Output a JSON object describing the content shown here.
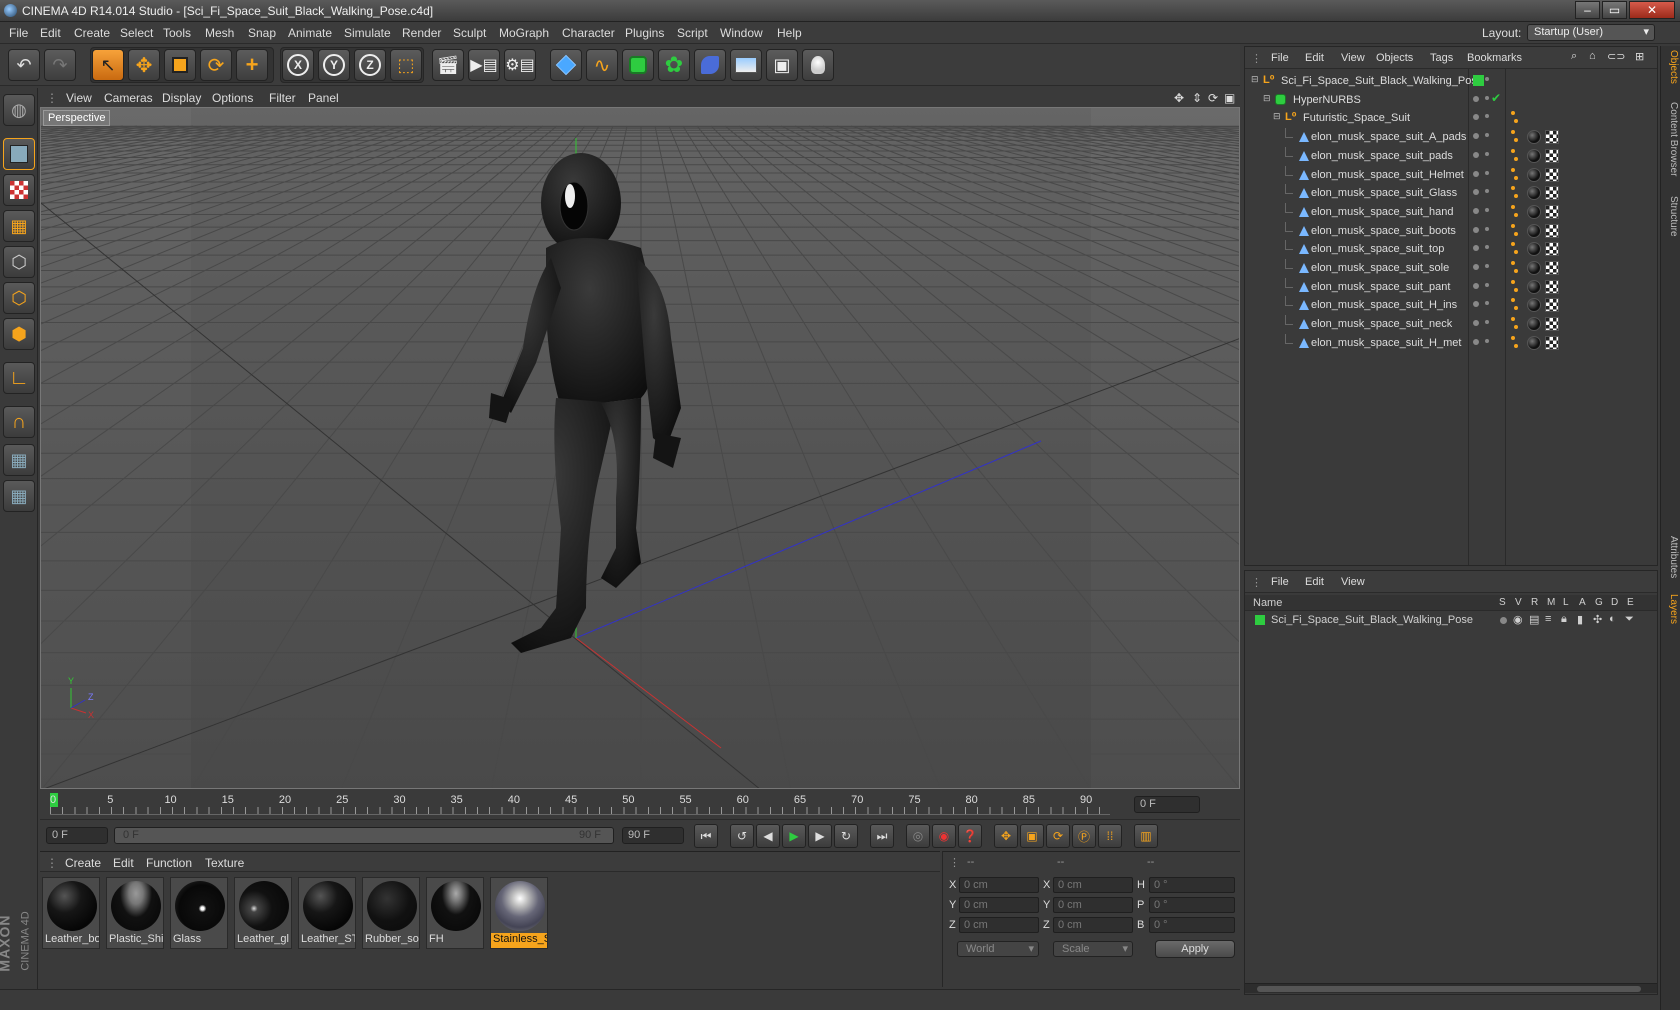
{
  "window": {
    "title": "CINEMA 4D R14.014 Studio - [Sci_Fi_Space_Suit_Black_Walking_Pose.c4d]",
    "controls": [
      "‒",
      "▭",
      "✕"
    ]
  },
  "menubar": {
    "items": [
      "File",
      "Edit",
      "Create",
      "Select",
      "Tools",
      "Mesh",
      "Snap",
      "Animate",
      "Simulate",
      "Render",
      "Sculpt",
      "MoGraph",
      "Character",
      "Plugins",
      "Script",
      "Window",
      "Help"
    ],
    "layout_label": "Layout:",
    "layout_value": "Startup (User)"
  },
  "toolbar": {
    "icons": [
      "undo-icon",
      "redo-icon",
      "select-icon",
      "move-icon",
      "scale-icon",
      "rotate-icon",
      "add-icon",
      "x-axis-icon",
      "y-axis-icon",
      "z-axis-icon",
      "world-coord-icon",
      "render-view-icon",
      "render-picture-icon",
      "render-settings-icon",
      "cube-icon",
      "spline-icon",
      "nurbs-icon",
      "array-icon",
      "deformer-icon",
      "scene-icon",
      "camera-icon",
      "light-icon"
    ],
    "axis_labels": [
      "X",
      "Y",
      "Z"
    ]
  },
  "viewport": {
    "menu": [
      "View",
      "Cameras",
      "Display",
      "Options",
      "Filter",
      "Panel"
    ],
    "label": "Perspective",
    "axis_labels": {
      "x": "X",
      "y": "Y",
      "z": "Z"
    }
  },
  "timeline": {
    "ticks": [
      "0",
      "5",
      "10",
      "15",
      "20",
      "25",
      "30",
      "35",
      "40",
      "45",
      "50",
      "55",
      "60",
      "65",
      "70",
      "75",
      "80",
      "85",
      "90"
    ],
    "current_frame": "0 F",
    "start_field": "0 F",
    "range_start": "0 F",
    "range_end": "90 F",
    "end_field": "90 F"
  },
  "materials": {
    "menu": [
      "Create",
      "Edit",
      "Function",
      "Texture"
    ],
    "items": [
      {
        "name": "Leather_bo"
      },
      {
        "name": "Plastic_Shin"
      },
      {
        "name": "Glass"
      },
      {
        "name": "Leather_gl"
      },
      {
        "name": "Leather_ST"
      },
      {
        "name": "Rubber_so"
      },
      {
        "name": "FH"
      },
      {
        "name": "Stainless_S"
      }
    ],
    "selected_index": 7
  },
  "coordinates": {
    "headers": [
      "--",
      "--",
      "--"
    ],
    "rows": [
      {
        "a": "X",
        "av": "0 cm",
        "b": "X",
        "bv": "0 cm",
        "c": "H",
        "cv": "0 °"
      },
      {
        "a": "Y",
        "av": "0 cm",
        "b": "Y",
        "bv": "0 cm",
        "c": "P",
        "cv": "0 °"
      },
      {
        "a": "Z",
        "av": "0 cm",
        "b": "Z",
        "bv": "0 cm",
        "c": "B",
        "cv": "0 °"
      }
    ],
    "mode": "World",
    "transform": "Scale",
    "apply": "Apply"
  },
  "objects": {
    "menu": [
      "File",
      "Edit",
      "View",
      "Objects",
      "Tags",
      "Bookmarks"
    ],
    "tree": [
      {
        "name": "Sci_Fi_Space_Suit_Black_Walking_Pose",
        "type": "null"
      },
      {
        "name": "HyperNURBS",
        "type": "nurbs"
      },
      {
        "name": "Futuristic_Space_Suit",
        "type": "null"
      },
      {
        "name": "elon_musk_space_suit_A_pads",
        "type": "mesh"
      },
      {
        "name": "elon_musk_space_suit_pads",
        "type": "mesh"
      },
      {
        "name": "elon_musk_space_suit_Helmet",
        "type": "mesh"
      },
      {
        "name": "elon_musk_space_suit_Glass",
        "type": "mesh"
      },
      {
        "name": "elon_musk_space_suit_hand",
        "type": "mesh"
      },
      {
        "name": "elon_musk_space_suit_boots",
        "type": "mesh"
      },
      {
        "name": "elon_musk_space_suit_top",
        "type": "mesh"
      },
      {
        "name": "elon_musk_space_suit_sole",
        "type": "mesh"
      },
      {
        "name": "elon_musk_space_suit_pant",
        "type": "mesh"
      },
      {
        "name": "elon_musk_space_suit_H_ins",
        "type": "mesh"
      },
      {
        "name": "elon_musk_space_suit_neck",
        "type": "mesh"
      },
      {
        "name": "elon_musk_space_suit_H_met",
        "type": "mesh"
      }
    ]
  },
  "layers": {
    "menu": [
      "File",
      "Edit",
      "View"
    ],
    "columns": [
      "Name",
      "S",
      "V",
      "R",
      "M",
      "L",
      "A",
      "G",
      "D",
      "E"
    ],
    "rows": [
      {
        "name": "Sci_Fi_Space_Suit_Black_Walking_Pose",
        "color": "#2ecc40"
      }
    ]
  },
  "side_tabs": [
    "Objects",
    "Content Browser",
    "Structure",
    "Attributes",
    "Layers"
  ],
  "brand": {
    "line1": "MAXON",
    "line2": "CINEMA 4D"
  },
  "colors": {
    "accent": "#f6a41c",
    "layer": "#2ecc40",
    "x_axis": "#c83232",
    "y_axis": "#32c832",
    "z_axis": "#3232c8"
  }
}
